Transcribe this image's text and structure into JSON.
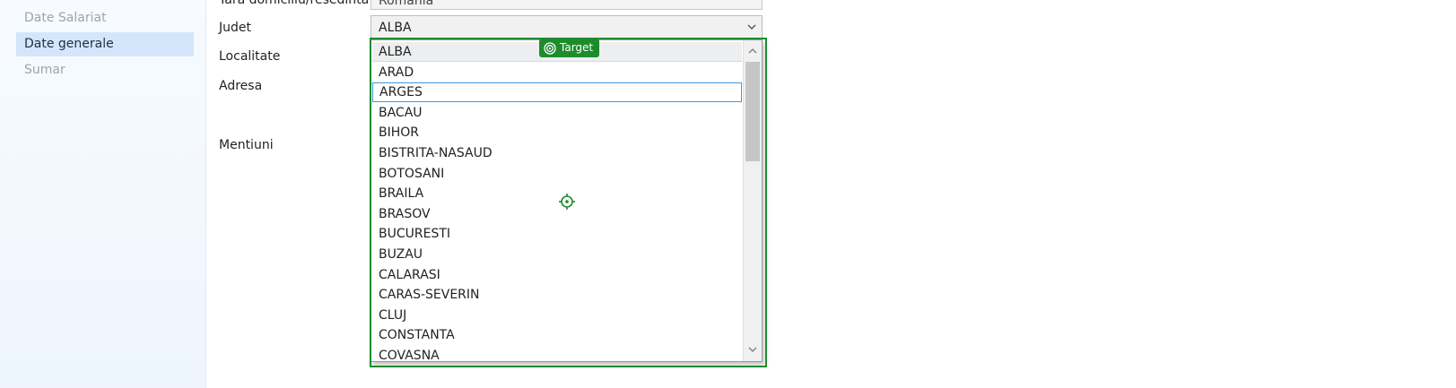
{
  "sidebar": {
    "items": [
      {
        "label": "Date Salariat",
        "active": false
      },
      {
        "label": "Date generale",
        "active": true
      },
      {
        "label": "Sumar",
        "active": false
      }
    ]
  },
  "form": {
    "tara_label": "Tara domiciliu/resedinta",
    "tara_value": "Romania",
    "judet_label": "Judet",
    "localitate_label": "Localitate",
    "adresa_label": "Adresa",
    "mentiuni_label": "Mentiuni",
    "judet_selected": "ALBA",
    "judet_arrow_icon": "chevron-down-icon"
  },
  "dropdown": {
    "items": [
      "ALBA",
      "ARAD",
      "ARGES",
      "BACAU",
      "BIHOR",
      "BISTRITA-NASAUD",
      "BOTOSANI",
      "BRAILA",
      "BRASOV",
      "BUCURESTI",
      "BUZAU",
      "CALARASI",
      "CARAS-SEVERIN",
      "CLUJ",
      "CONSTANTA",
      "COVASNA"
    ],
    "selected_index": 0,
    "focused_index": 2,
    "scroll_fraction": 0.0
  },
  "overlay": {
    "badge_label": "Target",
    "color": "#1e8c2d"
  }
}
